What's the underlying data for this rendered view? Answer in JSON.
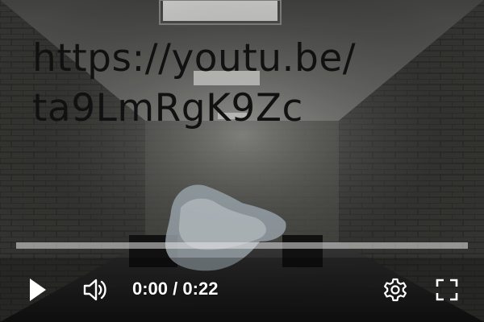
{
  "overlay": {
    "url_text": "https://youtu.be/\nta9LmRgK9Zc"
  },
  "player": {
    "progress": 0.0,
    "current_time": "0:00",
    "duration": "0:22",
    "time_separator": " / ",
    "progress_color": "#ff0000"
  },
  "controls": {
    "play_icon": "play-icon",
    "volume_icon": "volume-icon",
    "settings_icon": "gear-icon",
    "fullscreen_icon": "fullscreen-icon"
  }
}
